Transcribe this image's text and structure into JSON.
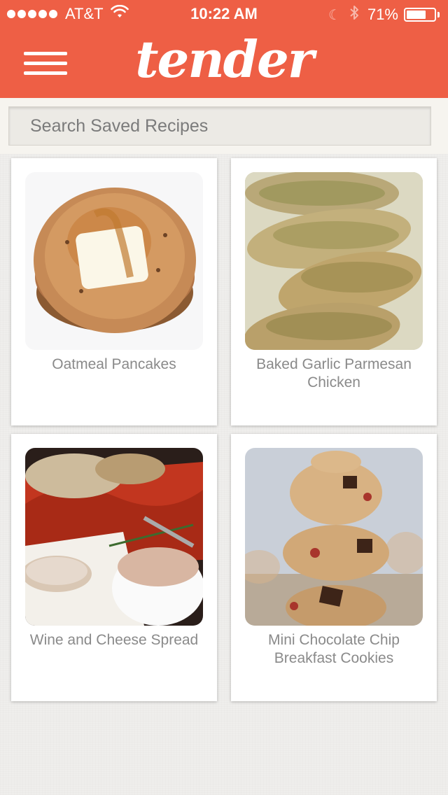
{
  "status": {
    "carrier": "AT&T",
    "time": "10:22 AM",
    "battery": "71%",
    "battery_level": 0.71
  },
  "header": {
    "logo_text": "tender",
    "menu_icon": "hamburger-menu-icon",
    "brand_color": "#ee5f45"
  },
  "search": {
    "placeholder": "Search Saved Recipes"
  },
  "recipes": [
    {
      "title": "Oatmeal Pancakes"
    },
    {
      "title": "Baked Garlic Parmesan Chicken"
    },
    {
      "title": "Wine and Cheese Spread"
    },
    {
      "title": "Mini Chocolate Chip Breakfast Cookies"
    }
  ]
}
